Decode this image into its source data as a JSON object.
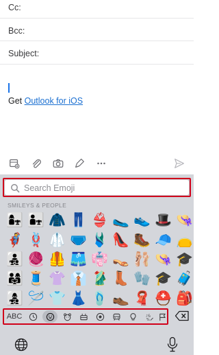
{
  "compose": {
    "cc_label": "Cc:",
    "bcc_label": "Bcc:",
    "subject_label": "Subject:",
    "signature_prefix": "Get ",
    "signature_link": "Outlook for iOS"
  },
  "toolbar": {
    "icons": [
      "attach-file-icon",
      "paperclip-icon",
      "camera-icon",
      "pen-icon",
      "more-icon",
      "send-icon"
    ]
  },
  "keyboard": {
    "search_placeholder": "Search Emoji",
    "section_label": "SMILEYS & PEOPLE",
    "emojis": [
      [
        "👩‍👧",
        "👨‍👧",
        "🧥",
        "👖",
        "👙",
        "🥿",
        "👟",
        "🎩",
        "👒"
      ],
      [
        "🦸",
        "🪢",
        "🥼",
        "🩲",
        "🩱",
        "👠",
        "🥾",
        "🧢",
        "👝"
      ],
      [
        "👨‍👧‍👦",
        "🧶",
        "🦺",
        "🩳",
        "👘",
        "👡",
        "🩰",
        "👒",
        "🎓"
      ],
      [
        "👨‍👩‍👧",
        "🧵",
        "👚",
        "👔",
        "🥻",
        "👢",
        "🧤",
        "🎓",
        "🧳"
      ],
      [
        "👩‍👧‍👦",
        "🪡",
        "👕",
        "👗",
        "🩴",
        "👞",
        "🧣",
        "⛑️",
        "🎒"
      ]
    ],
    "categories": [
      "ABC",
      "recent-icon",
      "smiley-icon",
      "animal-icon",
      "food-icon",
      "activity-icon",
      "travel-icon",
      "objects-icon",
      "symbols-icon",
      "flag-icon"
    ],
    "active_category": "smiley-icon",
    "accent_color": "#d0021b",
    "link_color": "#1a6fd1"
  }
}
